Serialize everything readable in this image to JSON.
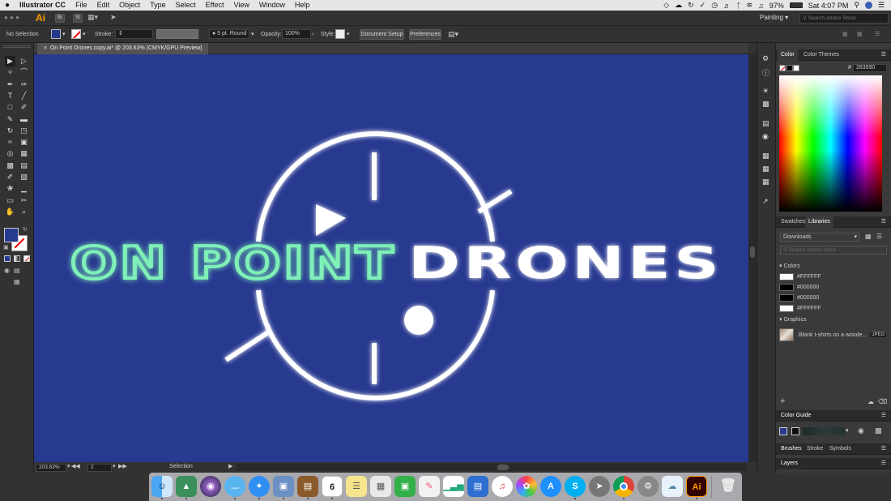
{
  "menubar": {
    "apple": "",
    "app": "Illustrator CC",
    "items": [
      "File",
      "Edit",
      "Object",
      "Type",
      "Select",
      "Effect",
      "View",
      "Window",
      "Help"
    ],
    "battery": "97%",
    "clock": "Sat 4:07 PM"
  },
  "appbar": {
    "logo": "Ai",
    "br": "Br",
    "st": "St",
    "workspace": "Painting",
    "stock_placeholder": "Search Adobe Stock"
  },
  "control": {
    "selection": "No Selection",
    "stroke_label": "Stroke:",
    "brush": "5 pt. Round",
    "opacity_label": "Opacity:",
    "opacity": "100%",
    "style_label": "Style:",
    "doc_setup": "Document Setup",
    "preferences": "Preferences"
  },
  "document": {
    "tab": "On Point Drones copy.ai* @ 203.63% (CMYK/GPU Preview)",
    "close": "×",
    "zoom": "203.63%",
    "page": "2",
    "status": "Selection"
  },
  "artwork": {
    "word1": "ON POINT",
    "word2": "DRONES",
    "bg": "#283990",
    "glow": "#7ff0b8"
  },
  "color_panel": {
    "tabs": [
      "Color",
      "Color Themes"
    ],
    "hex_prefix": "#",
    "hex": "283990"
  },
  "libraries_panel": {
    "tabs": [
      "Swatches",
      "Libraries"
    ],
    "library": "Downloads",
    "search_placeholder": "Search Adobe Stock",
    "colors_header": "Colors",
    "colors": [
      {
        "hex": "#FFFFFF",
        "label": "#FFFFFF"
      },
      {
        "hex": "#000000",
        "label": "#000000"
      },
      {
        "hex": "#000000",
        "label": "#000000"
      },
      {
        "hex": "#FFFFFF",
        "label": "#FFFFFF"
      }
    ],
    "graphics_header": "Graphics",
    "graphic_label": "Blank t-shirts on a woode...",
    "graphic_type": "JPEG",
    "add": "+"
  },
  "color_guide": {
    "title": "Color Guide"
  },
  "bottom_panels": {
    "tabs": [
      "Brushes",
      "Stroke",
      "Symbols"
    ],
    "layers": "Layers"
  },
  "dock": {
    "calendar_day": "6",
    "ai_label": "Ai"
  }
}
